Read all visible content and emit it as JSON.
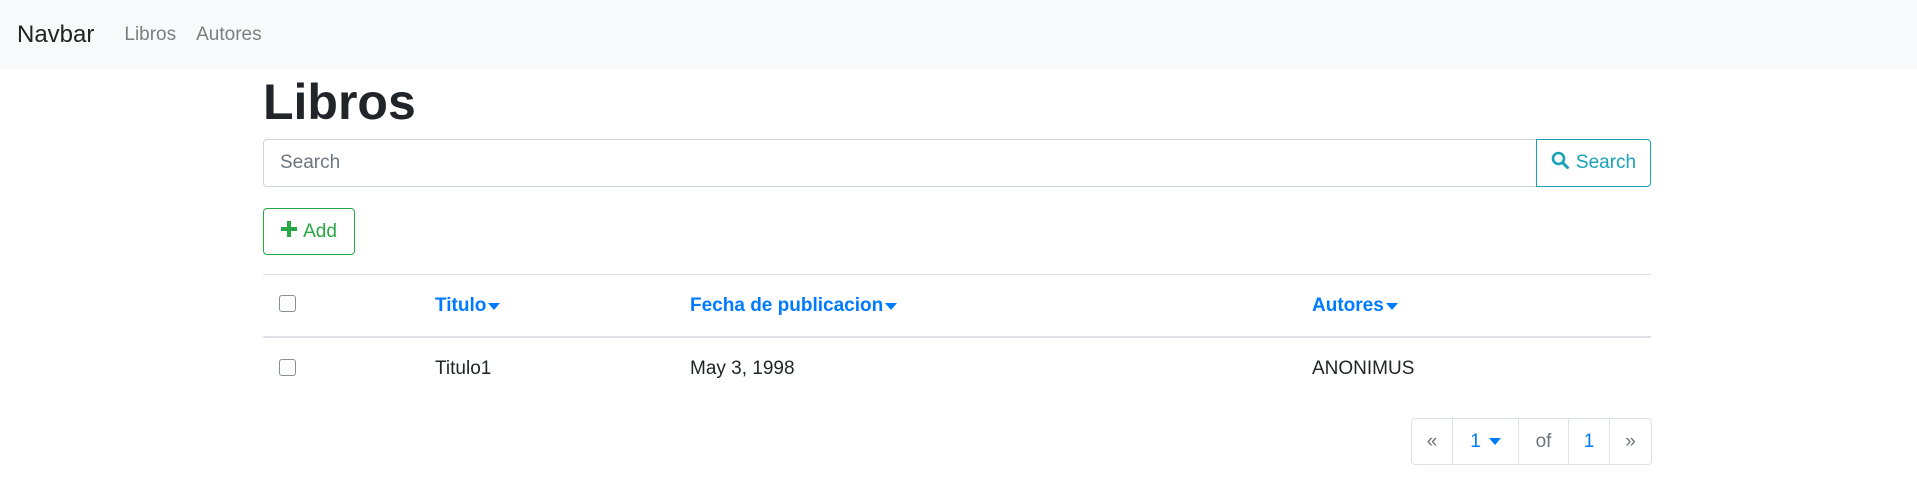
{
  "navbar": {
    "brand": "Navbar",
    "links": [
      "Libros",
      "Autores"
    ]
  },
  "page": {
    "title": "Libros"
  },
  "search": {
    "placeholder": "Search",
    "value": "",
    "button_label": "Search"
  },
  "toolbar": {
    "add_label": "Add"
  },
  "table": {
    "columns": [
      "Titulo",
      "Fecha de publicacion",
      "Autores"
    ],
    "rows": [
      {
        "titulo": "Titulo1",
        "fecha": "May 3, 1998",
        "autores": "ANONIMUS"
      }
    ]
  },
  "pagination": {
    "prev": "«",
    "current_page": "1",
    "of_label": "of",
    "total_pages": "1",
    "next": "»"
  },
  "colors": {
    "link": "#007bff",
    "info": "#17a2b8",
    "success": "#28a745",
    "navbar_bg": "#f8f9fa"
  }
}
